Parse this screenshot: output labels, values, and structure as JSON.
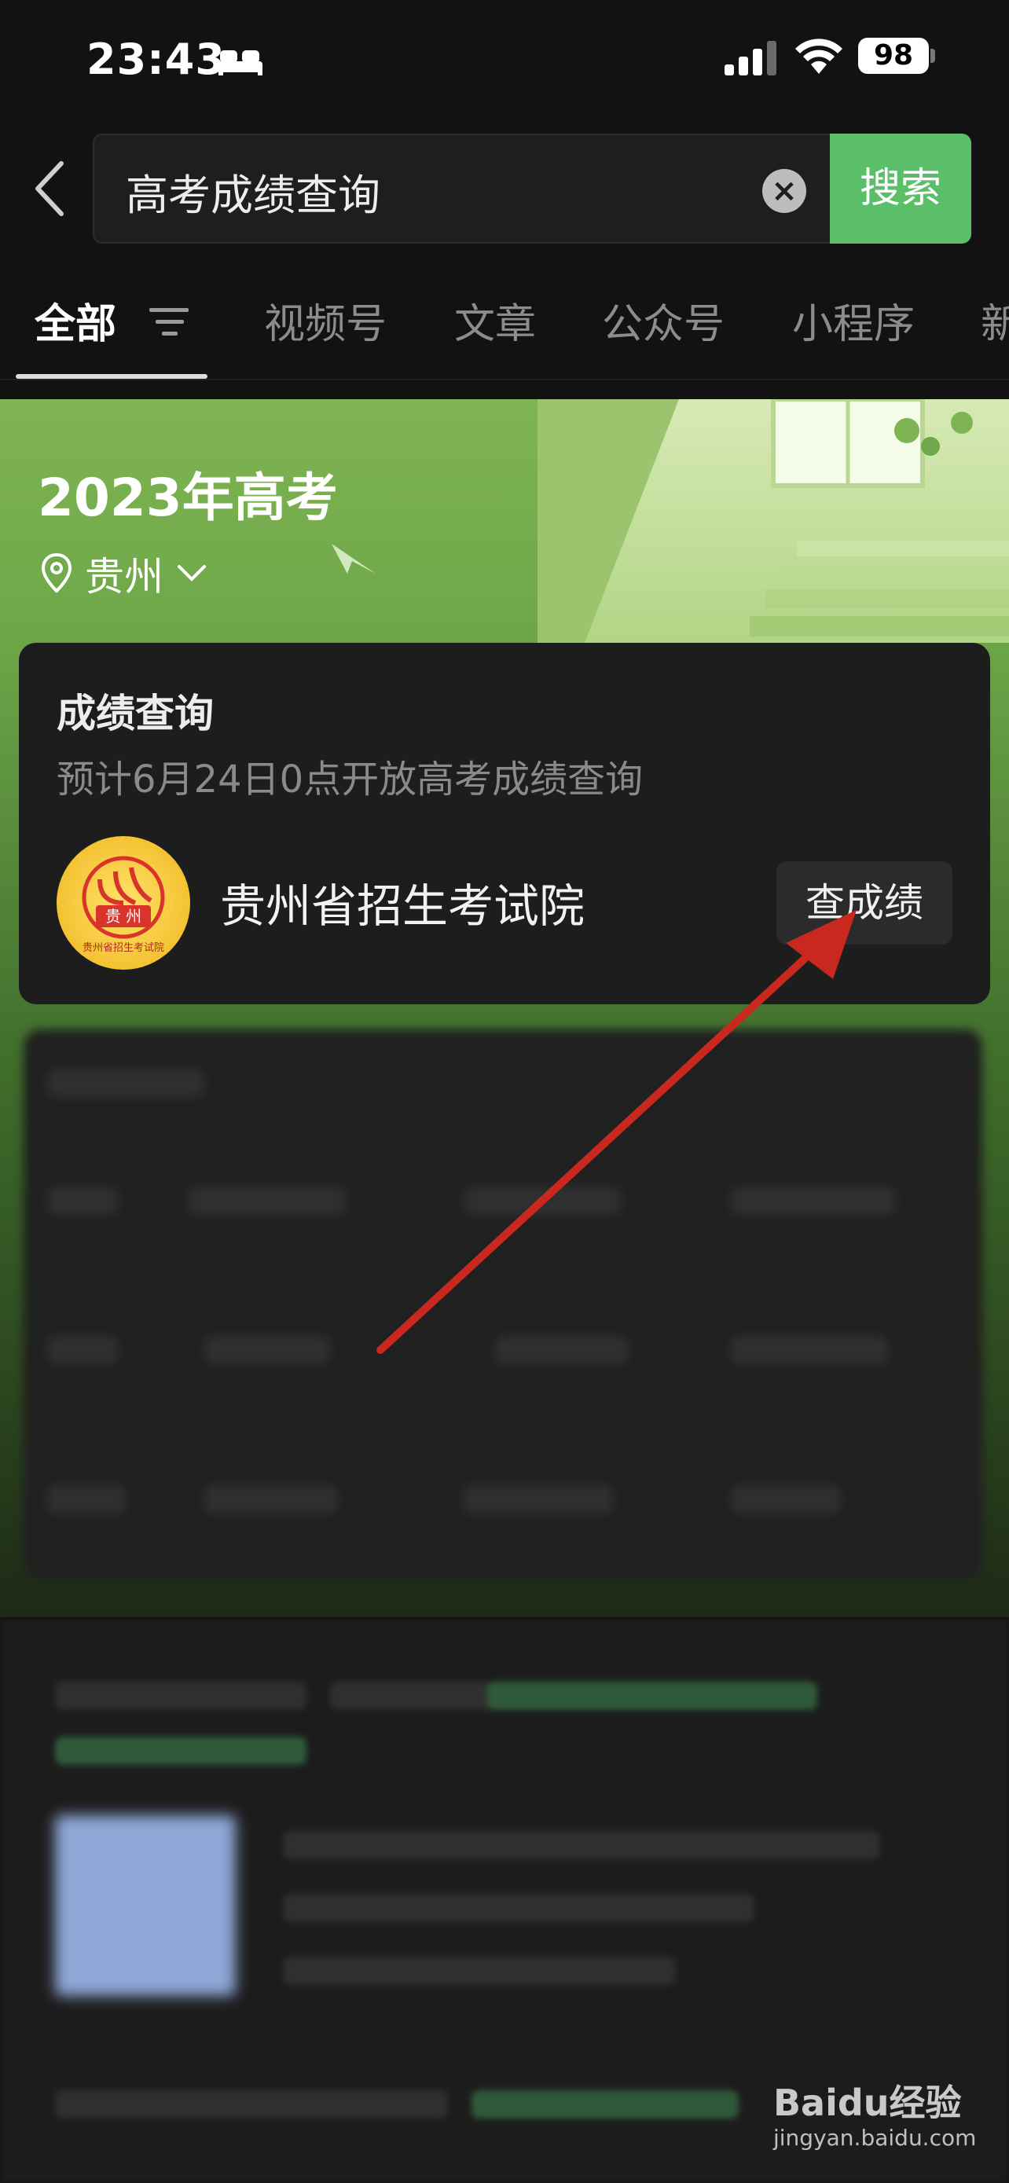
{
  "status_bar": {
    "time": "23:43",
    "battery": "98"
  },
  "search": {
    "query": "高考成绩查询",
    "clear_symbol": "×",
    "button_label": "搜索"
  },
  "tabs": [
    {
      "label": "全部"
    },
    {
      "label": "视频号"
    },
    {
      "label": "文章"
    },
    {
      "label": "公众号"
    },
    {
      "label": "小程序"
    },
    {
      "label": "新"
    }
  ],
  "banner": {
    "title": "2023年高考",
    "location": "贵州"
  },
  "score_card": {
    "title": "成绩查询",
    "subtitle": "预计6月24日0点开放高考成绩查询",
    "org_name": "贵州省招生考试院",
    "logo_text": "贵 州",
    "logo_caption": "贵州省招生考试院",
    "action_label": "查成绩"
  },
  "annotation": {
    "color": "#c8281e"
  },
  "watermark": {
    "brand": "Baidu经验",
    "url": "jingyan.baidu.com"
  },
  "colors": {
    "accent": "#5bbf6a",
    "background": "#121212",
    "card": "#1d1d1d"
  },
  "icons": [
    "bed-icon",
    "signal-icon",
    "wifi-icon",
    "battery-icon",
    "back-icon",
    "clear-icon",
    "filter-icon",
    "location-pin-icon",
    "chevron-down-icon"
  ]
}
